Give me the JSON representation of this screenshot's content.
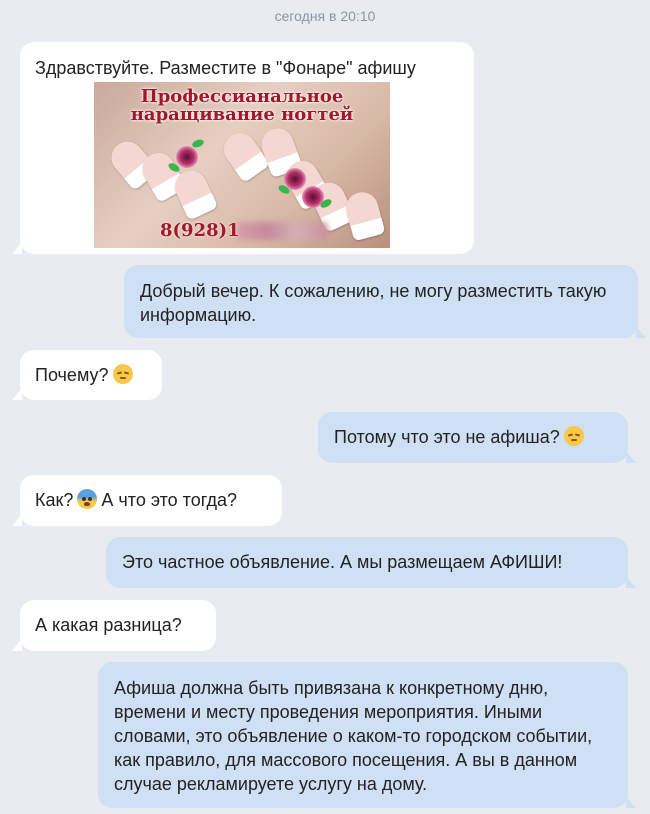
{
  "chat": {
    "date_divider": "сегодня в 20:10",
    "messages": [
      {
        "text": "Здравствуйте. Разместите в \"Фонаре\" афишу"
      },
      {
        "text": "Добрый вечер. К сожалению, не могу разместить такую информацию."
      },
      {
        "text": "Почему?",
        "emoji": "pensive-face-icon"
      },
      {
        "text": "Потому что это не афиша?",
        "emoji": "pensive-face-icon"
      },
      {
        "text_before": "Как?",
        "emoji": "fearful-face-icon",
        "text_after": "А что это тогда?"
      },
      {
        "text": "Это частное объявление. А мы размещаем АФИШИ!"
      },
      {
        "text": "А какая разница?"
      },
      {
        "text": "Афиша должна быть привязана к конкретному дню, времени и месту проведения мероприятия. Иными словами, это объявление о каком-то городском событии, как правило, для массового посещения. А вы в данном случае рекламируете услугу на дому."
      }
    ],
    "ad_image": {
      "title_line1": "Профессианальное",
      "title_line2": "наращивание ногтей",
      "phone_visible": "8(928)1"
    }
  },
  "colors": {
    "background": "#e8ecf1",
    "incoming_bubble": "#ffffff",
    "outgoing_bubble": "#cfe0f4"
  }
}
